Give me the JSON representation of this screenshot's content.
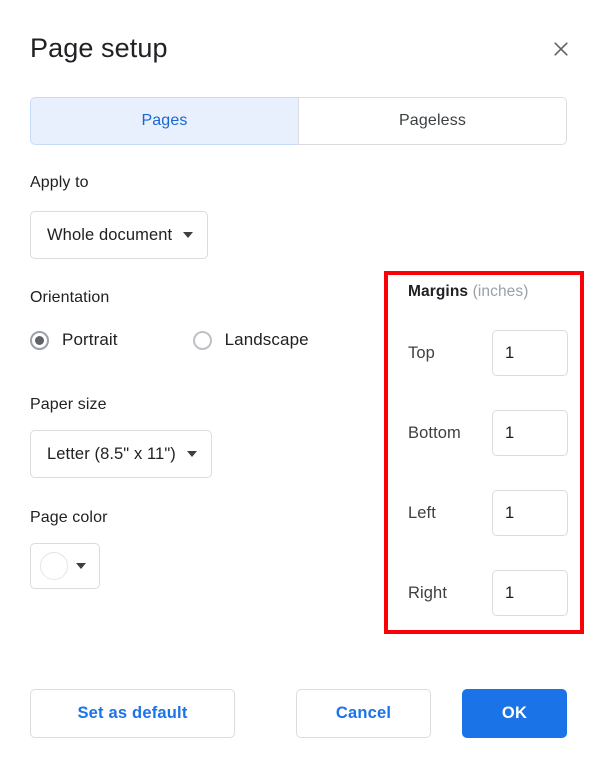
{
  "dialog": {
    "title": "Page setup",
    "close_icon": "close-icon"
  },
  "tabs": [
    {
      "label": "Pages",
      "selected": true
    },
    {
      "label": "Pageless",
      "selected": false
    }
  ],
  "apply_to": {
    "label": "Apply to",
    "value": "Whole document"
  },
  "orientation": {
    "label": "Orientation",
    "options": [
      {
        "label": "Portrait",
        "checked": true
      },
      {
        "label": "Landscape",
        "checked": false
      }
    ]
  },
  "paper_size": {
    "label": "Paper size",
    "value": "Letter (8.5\" x 11\")"
  },
  "page_color": {
    "label": "Page color",
    "swatch_color": "#ffffff"
  },
  "margins": {
    "title": "Margins",
    "unit": "(inches)",
    "fields": [
      {
        "label": "Top",
        "value": "1"
      },
      {
        "label": "Bottom",
        "value": "1"
      },
      {
        "label": "Left",
        "value": "1"
      },
      {
        "label": "Right",
        "value": "1"
      }
    ]
  },
  "footer": {
    "set_as_default": "Set as default",
    "cancel": "Cancel",
    "ok": "OK"
  },
  "colors": {
    "accent_blue": "#1b73e8",
    "tab_selected_bg": "#e8f0fe",
    "tab_selected_text": "#1967d2",
    "annotation_red": "#fb0007"
  }
}
